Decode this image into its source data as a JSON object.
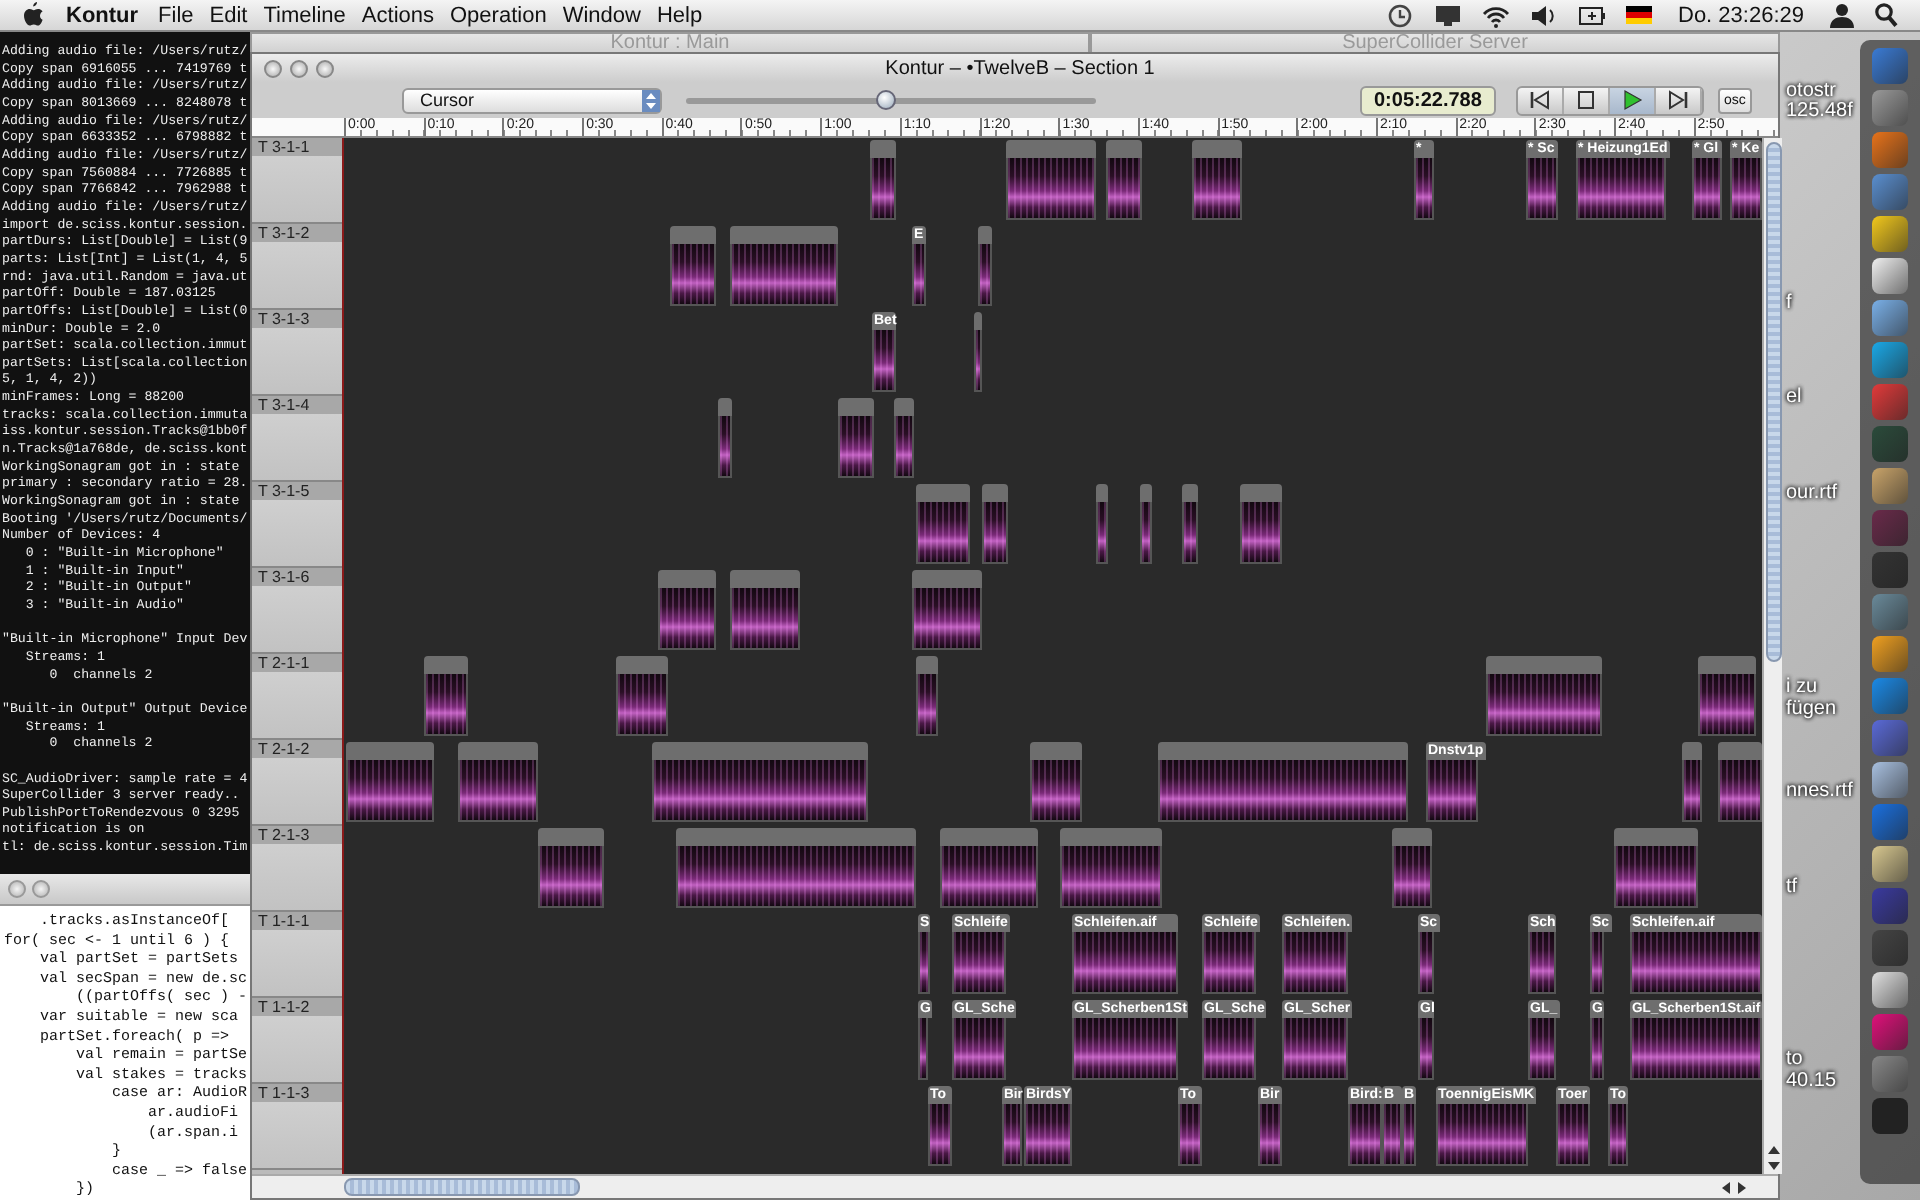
{
  "menu_bar": {
    "app": "Kontur",
    "items": [
      "File",
      "Edit",
      "Timeline",
      "Actions",
      "Operation",
      "Window",
      "Help"
    ],
    "clock": "Do. 23:26:29"
  },
  "background_windows": [
    {
      "title": "Kontur : Main"
    },
    {
      "title": "SuperCollider Server"
    }
  ],
  "console": {
    "blocks": [
      [
        "Adding audio file: /Users/rutz/",
        "Copy span 6916055 ... 7419769 t",
        "Adding audio file: /Users/rutz/",
        "Copy span 8013669 ... 8248078 t",
        "Adding audio file: /Users/rutz/",
        "Copy span 6633352 ... 6798882 t",
        "Adding audio file: /Users/rutz/",
        "Copy span 7560884 ... 7726885 t",
        "Copy span 7766842 ... 7962988 t",
        "Adding audio file: /Users/rutz/",
        "import de.sciss.kontur.session.",
        "partDurs: List[Double] = List(9",
        "parts: List[Int] = List(1, 4, 5",
        "rnd: java.util.Random = java.ut",
        "partOff: Double = 187.03125",
        "partOffs: List[Double] = List(0",
        "minDur: Double = 2.0",
        "partSet: scala.collection.immut",
        "partSets: List[scala.collection",
        "5, 1, 4, 2))",
        "minFrames: Long = 88200",
        "tracks: scala.collection.immuta",
        "iss.kontur.session.Tracks@1bb0f",
        "n.Tracks@1a768de, de.sciss.kont",
        "WorkingSonagram got in : state",
        "primary : secondary ratio = 28.",
        "WorkingSonagram got in : state",
        "Booting '/Users/rutz/Documents/",
        "Number of Devices: 4",
        "   0 : \"Built-in Microphone\"",
        "   1 : \"Built-in Input\"",
        "   2 : \"Built-in Output\"",
        "   3 : \"Built-in Audio\""
      ],
      [
        "\"Built-in Microphone\" Input Dev",
        "   Streams: 1",
        "      0  channels 2"
      ],
      [
        "\"Built-in Output\" Output Device",
        "   Streams: 1",
        "      0  channels 2"
      ],
      [
        "SC_AudioDriver: sample rate = 4",
        "SuperCollider 3 server ready..",
        "PublishPortToRendezvous 0 3295",
        "notification is on",
        "tl: de.sciss.kontur.session.Tim"
      ]
    ]
  },
  "editor": {
    "lines": [
      "    .tracks.asInstanceOf[",
      "for( sec <- 1 until 6 ) {",
      "    val partSet = partSets",
      "    val secSpan = new de.sc",
      "        ((partOffs( sec ) -",
      "    var suitable = new sca",
      "    partSet.foreach( p =>",
      "        val remain = partSe",
      "        val stakes = tracks",
      "            case ar: AudioR",
      "                ar.audioFi",
      "                (ar.span.i",
      "            }",
      "            case _ => false",
      "        })"
    ]
  },
  "desktop_labels": [
    "otostr",
    "125.48f",
    "f",
    "el",
    "our.rtf",
    "i zu",
    "fügen",
    "nnes.rtf",
    "tf",
    "to",
    "40.15"
  ],
  "main_window": {
    "title": "Kontur – •TwelveB – Section 1",
    "tool": "Cursor",
    "zoom_slider": {
      "level": 0.49
    },
    "time": "0:05:22.788",
    "transport": [
      {
        "kind": "rewind",
        "selected": false
      },
      {
        "kind": "stop",
        "selected": false
      },
      {
        "kind": "play",
        "selected": true
      },
      {
        "kind": "end",
        "selected": false
      }
    ],
    "osc_button": "osc",
    "ruler_ticks": [
      "0:00",
      "0:10",
      "0:20",
      "0:30",
      "0:40",
      "0:50",
      "1:00",
      "1:10",
      "1:20",
      "1:30",
      "1:40",
      "1:50",
      "2:00",
      "2:10",
      "2:20",
      "2:30",
      "2:40",
      "2:50"
    ],
    "tracks": [
      {
        "label": "T 3-1-1",
        "regions": [
          {
            "kind": "audio"
          },
          {
            "kind": "audio"
          },
          {
            "kind": "audio"
          },
          {
            "kind": "audio"
          },
          {
            "kind": "audio",
            "name": "*"
          },
          {
            "kind": "audio",
            "name": "* Sc"
          },
          {
            "kind": "audio",
            "name": "* Heizung1Ed"
          },
          {
            "kind": "audio",
            "name": "* Gl"
          },
          {
            "kind": "audio",
            "name": "* Ke"
          }
        ]
      },
      {
        "label": "T 3-1-2",
        "regions": [
          {
            "kind": "audio"
          },
          {
            "kind": "audio"
          },
          {
            "kind": "audio",
            "name": "E"
          },
          {
            "kind": "audio"
          }
        ]
      },
      {
        "label": "T 3-1-3",
        "regions": [
          {
            "kind": "audio",
            "name": "Bet"
          },
          {
            "kind": "audio"
          }
        ]
      },
      {
        "label": "T 3-1-4",
        "regions": [
          {
            "kind": "audio"
          },
          {
            "kind": "audio"
          },
          {
            "kind": "audio"
          }
        ]
      },
      {
        "label": "T 3-1-5",
        "regions": [
          {
            "kind": "audio"
          },
          {
            "kind": "audio"
          },
          {
            "kind": "audio"
          },
          {
            "kind": "audio"
          },
          {
            "kind": "audio"
          },
          {
            "kind": "audio"
          }
        ]
      },
      {
        "label": "T 3-1-6",
        "regions": [
          {
            "kind": "audio"
          },
          {
            "kind": "audio"
          },
          {
            "kind": "audio"
          }
        ]
      },
      {
        "label": "T 2-1-1",
        "regions": [
          {
            "kind": "audio"
          },
          {
            "kind": "audio"
          },
          {
            "kind": "audio"
          },
          {
            "kind": "audio"
          },
          {
            "kind": "audio"
          }
        ]
      },
      {
        "label": "T 2-1-2",
        "regions": [
          {
            "kind": "audio"
          },
          {
            "kind": "audio"
          },
          {
            "kind": "audio"
          },
          {
            "kind": "audio"
          },
          {
            "kind": "audio"
          },
          {
            "kind": "audio",
            "name": "Dnstv1p"
          },
          {
            "kind": "audio"
          },
          {
            "kind": "audio"
          }
        ]
      },
      {
        "label": "T 2-1-3",
        "regions": [
          {
            "kind": "audio"
          },
          {
            "kind": "audio"
          },
          {
            "kind": "audio"
          },
          {
            "kind": "audio"
          },
          {
            "kind": "audio"
          },
          {
            "kind": "audio"
          }
        ]
      },
      {
        "label": "T 1-1-1",
        "regions": [
          {
            "kind": "audio",
            "name": "S"
          },
          {
            "kind": "audio",
            "name": "Schleife"
          },
          {
            "kind": "audio",
            "name": "Schleifen.aif"
          },
          {
            "kind": "audio",
            "name": "Schleife"
          },
          {
            "kind": "audio",
            "name": "Schleifen."
          },
          {
            "kind": "audio",
            "name": "Sc"
          },
          {
            "kind": "audio",
            "name": "Sch"
          },
          {
            "kind": "audio",
            "name": "Sc"
          },
          {
            "kind": "audio",
            "name": "Schleifen.aif"
          }
        ]
      },
      {
        "label": "T 1-1-2",
        "regions": [
          {
            "kind": "audio",
            "name": "G"
          },
          {
            "kind": "audio",
            "name": "GL_Sche"
          },
          {
            "kind": "audio",
            "name": "GL_Scherben1St"
          },
          {
            "kind": "audio",
            "name": "GL_Sche"
          },
          {
            "kind": "audio",
            "name": "GL_Scher"
          },
          {
            "kind": "audio",
            "name": "Gl"
          },
          {
            "kind": "audio",
            "name": "GL_"
          },
          {
            "kind": "audio",
            "name": "G"
          },
          {
            "kind": "audio",
            "name": "GL_Scherben1St.aif"
          }
        ]
      },
      {
        "label": "T 1-1-3",
        "regions": [
          {
            "kind": "audio",
            "name": "To"
          },
          {
            "kind": "audio",
            "name": "Bir"
          },
          {
            "kind": "audio",
            "name": "BirdsY"
          },
          {
            "kind": "audio",
            "name": "To"
          },
          {
            "kind": "audio",
            "name": "Bir"
          },
          {
            "kind": "audio",
            "name": "Bird:"
          },
          {
            "kind": "audio",
            "name": "B"
          },
          {
            "kind": "audio",
            "name": "B"
          },
          {
            "kind": "audio",
            "name": "ToennigEisMK"
          },
          {
            "kind": "audio",
            "name": "Toer"
          },
          {
            "kind": "audio",
            "name": "To"
          }
        ]
      }
    ]
  }
}
